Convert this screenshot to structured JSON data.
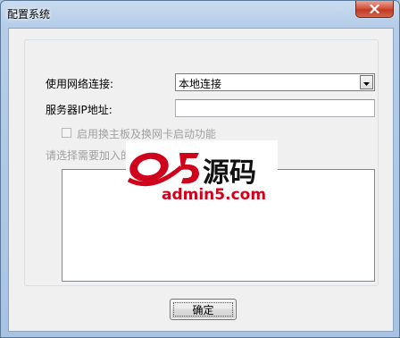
{
  "window": {
    "title": "配置系统",
    "close_icon": "close-icon"
  },
  "form": {
    "network_label": "使用网络连接:",
    "network_selected": "本地连接",
    "server_ip_label": "服务器IP地址:",
    "server_ip_value": "",
    "switch_checkbox_label": "启用换主板及换网卡启动功能",
    "switch_checkbox_checked": false,
    "list_prompt": "请选择需要加入的网卡信息",
    "list_items": []
  },
  "buttons": {
    "ok_label": "确定"
  },
  "watermark": {
    "logo_text": "a5源码",
    "site_text": "admin5.com"
  },
  "colors": {
    "close_button": "#c23a24",
    "watermark_red": "#d0021b",
    "disabled_text": "#a0a0a0"
  }
}
